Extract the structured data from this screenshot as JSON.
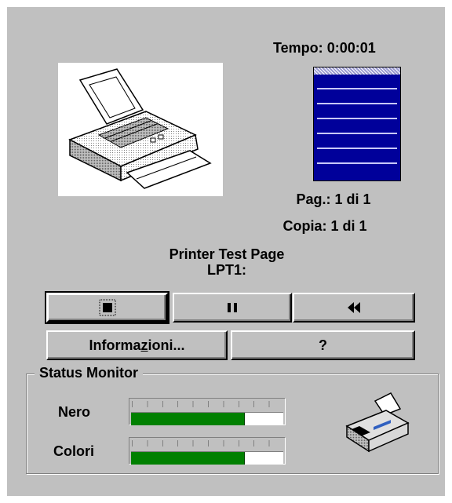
{
  "timer": {
    "label": "Tempo:",
    "value": "0:00:01"
  },
  "progress": {
    "fraction": 0.06
  },
  "page_info": {
    "label": "Pag.:",
    "value": "1 di 1"
  },
  "copy_info": {
    "label": "Copia:",
    "value": "1 di 1"
  },
  "document": {
    "name": "Printer Test Page",
    "port": "LPT1:"
  },
  "controls": {
    "stop_icon": "stop-icon",
    "pause_icon": "pause-icon",
    "rewind_icon": "rewind-icon",
    "info_label_pre": "Informa",
    "info_label_mnemonic": "z",
    "info_label_post": "ioni...",
    "help_label": "?"
  },
  "status_monitor": {
    "title": "Status Monitor",
    "inks": [
      {
        "name": "Nero",
        "level": 0.74,
        "color": "#008000"
      },
      {
        "name": "Colori",
        "level": 0.74,
        "color": "#008000"
      }
    ]
  },
  "colors": {
    "window_bg": "#c0c0c0",
    "progress_bg": "#00009a",
    "ink_green": "#008000"
  }
}
